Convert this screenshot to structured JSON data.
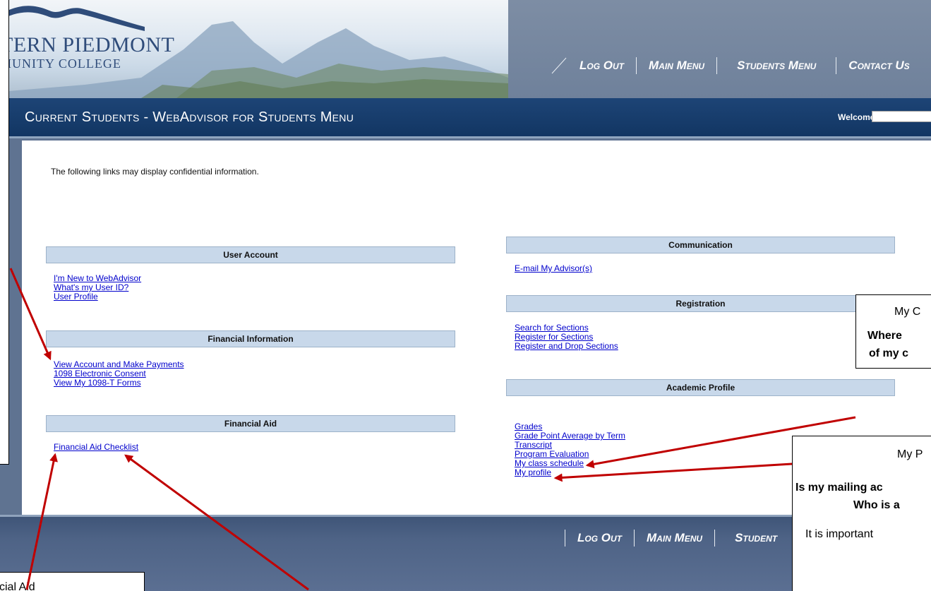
{
  "logo": {
    "line1": "TERN PIEDMONT",
    "line2": "MUNITY COLLEGE"
  },
  "nav": {
    "logout": "Log Out",
    "main_menu": "Main Menu",
    "students_menu": "Students Menu",
    "contact_us": "Contact Us",
    "bottom_students_partial": "Student"
  },
  "title": "Current Students - WebAdvisor for Students Menu",
  "welcome": "Welcome",
  "notice": "The following links may display confidential information.",
  "sections": {
    "user_account": {
      "title": "User Account",
      "links": [
        "I'm New to WebAdvisor",
        "What's my User ID?",
        "User Profile"
      ]
    },
    "financial_information": {
      "title": "Financial Information",
      "links": [
        "View Account and Make Payments",
        "1098 Electronic Consent",
        "View My 1098-T Forms"
      ]
    },
    "financial_aid": {
      "title": "Financial Aid",
      "links": [
        "Financial Aid Checklist"
      ]
    },
    "communication": {
      "title": "Communication",
      "links": [
        "E-mail My Advisor(s)"
      ]
    },
    "registration": {
      "title": "Registration",
      "links": [
        "Search for Sections",
        "Register for Sections",
        "Register and Drop Sections"
      ]
    },
    "academic_profile": {
      "title": "Academic Profile",
      "links": [
        "Grades",
        "Grade Point Average by Term",
        "Transcript",
        "Program Evaluation",
        "My class schedule",
        "My profile"
      ]
    }
  },
  "callouts": {
    "schedule": {
      "line1": "My C",
      "line2": "Where",
      "line3": "of my c"
    },
    "profile": {
      "line1": "My P",
      "line2": "Is my mailing ac",
      "line3": "Who is a",
      "line4": "It is important"
    },
    "aid": {
      "line1": "cial Aid"
    }
  },
  "colors": {
    "header_blue": "#1d4476",
    "section_header": "#c8d8ea",
    "link": "#0000cc",
    "arrow": "#c00000"
  }
}
